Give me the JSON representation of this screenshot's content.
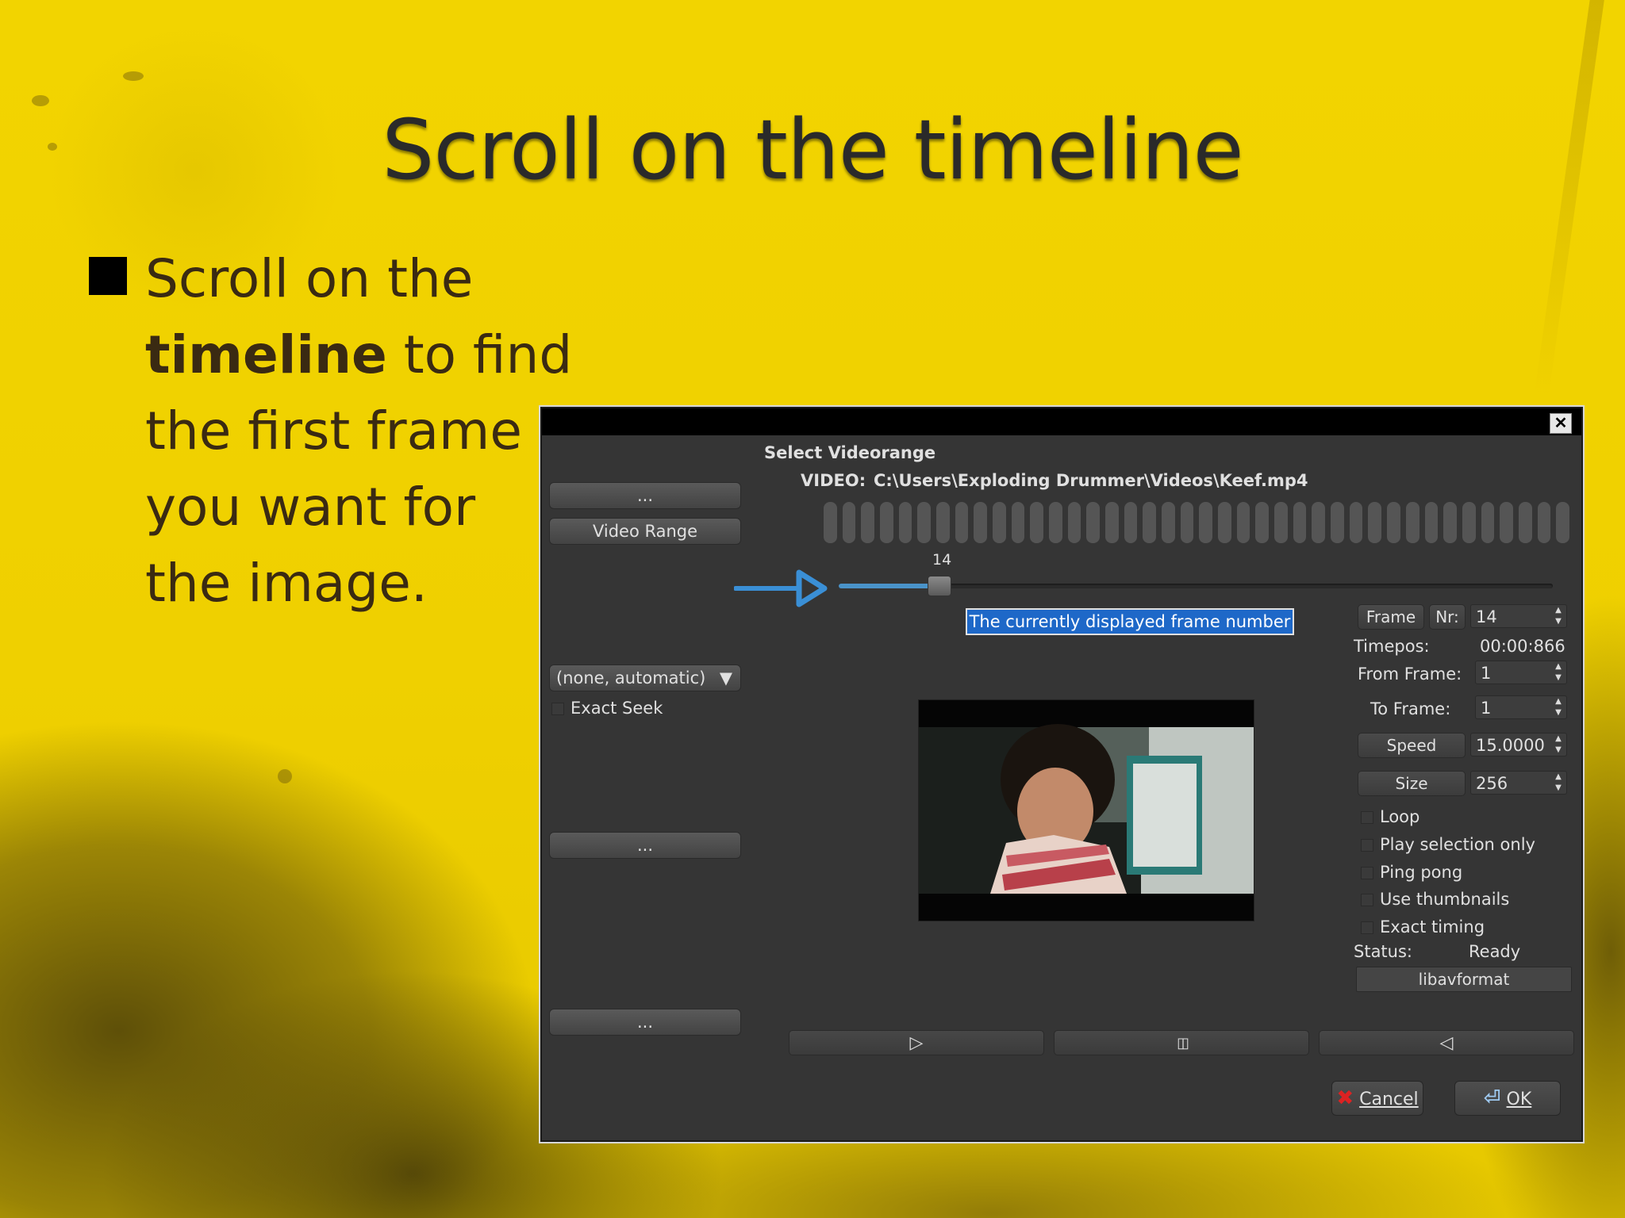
{
  "slide": {
    "title": "Scroll on the timeline",
    "bullet_pre": "Scroll on the",
    "bullet_bold": "timeline",
    "bullet_post": "to find the first frame you want for the image."
  },
  "dialog": {
    "close_glyph": "✕",
    "heading": "Select Videorange",
    "video_label": "VIDEO:",
    "video_path": "C:\\Users\\Exploding Drummer\\Videos\\Keef.mp4",
    "side_buttons": [
      "...",
      "Video Range",
      "...",
      "..."
    ],
    "decoder_select": "(none, automatic)",
    "exact_seek_label": "Exact Seek",
    "timeline": {
      "current_frame": "14",
      "progress_percent": 14
    },
    "tooltip": "The currently displayed frame number",
    "fields": {
      "frame_button": "Frame",
      "nr_label": "Nr:",
      "frame_value": "14",
      "timepos_label": "Timepos:",
      "timepos_value": "00:00:866",
      "from_frame_label": "From Frame:",
      "from_frame_value": "1",
      "to_frame_label": "To Frame:",
      "to_frame_value": "1",
      "speed_button": "Speed",
      "speed_value": "15.0000",
      "size_button": "Size",
      "size_value": "256"
    },
    "options": [
      "Loop",
      "Play selection only",
      "Ping pong",
      "Use thumbnails",
      "Exact timing"
    ],
    "status_label": "Status:",
    "status_value": "Ready",
    "backend": "libavformat",
    "transport": {
      "play_glyph": "▷",
      "pause_glyph": "▯▯",
      "reverse_glyph": "◁"
    },
    "cancel_label": "Cancel",
    "ok_label": "OK"
  },
  "colors": {
    "slide_bg": "#f2d400",
    "dialog_bg": "#353535",
    "accent_blue": "#4a93c9",
    "tooltip_bg": "#1e68c8"
  }
}
